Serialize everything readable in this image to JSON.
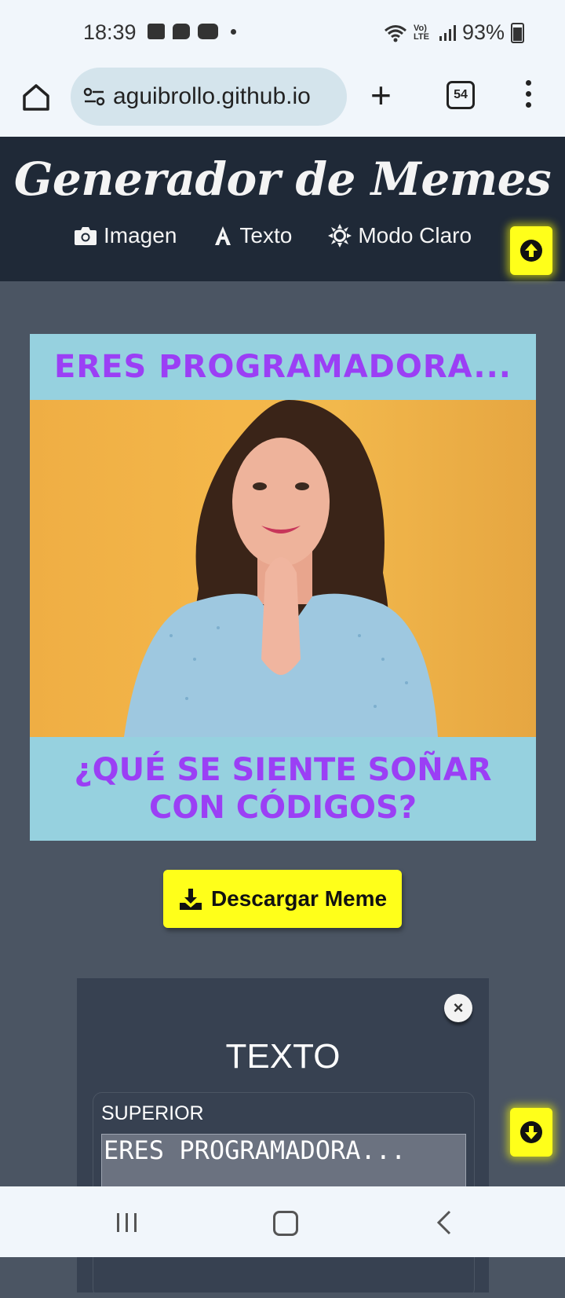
{
  "status_bar": {
    "time": "18:39",
    "battery": "93%",
    "network": "Vo) LTE"
  },
  "browser": {
    "url": "aguibrollo.github.io",
    "tab_count": "54"
  },
  "header": {
    "title": "Generador de Memes",
    "nav": [
      {
        "label": "Imagen",
        "icon": "camera-icon"
      },
      {
        "label": "Texto",
        "icon": "font-icon"
      },
      {
        "label": "Modo Claro",
        "icon": "sun-icon"
      }
    ]
  },
  "meme": {
    "top_text": "ERES PROGRAMADORA...",
    "bottom_text": "¿QUÉ SE SIENTE SOÑAR CON CÓDIGOS?",
    "background_color": "#96d1df",
    "text_color": "#9b3ff5"
  },
  "actions": {
    "download_label": "Descargar Meme"
  },
  "panel": {
    "title": "TEXTO",
    "close_label": "×",
    "field_label": "SUPERIOR",
    "field_value": "ERES PROGRAMADORA..."
  },
  "colors": {
    "accent": "#ffff1a",
    "header_bg": "#1f2937",
    "page_bg": "#4b5563",
    "panel_bg": "#374151"
  }
}
